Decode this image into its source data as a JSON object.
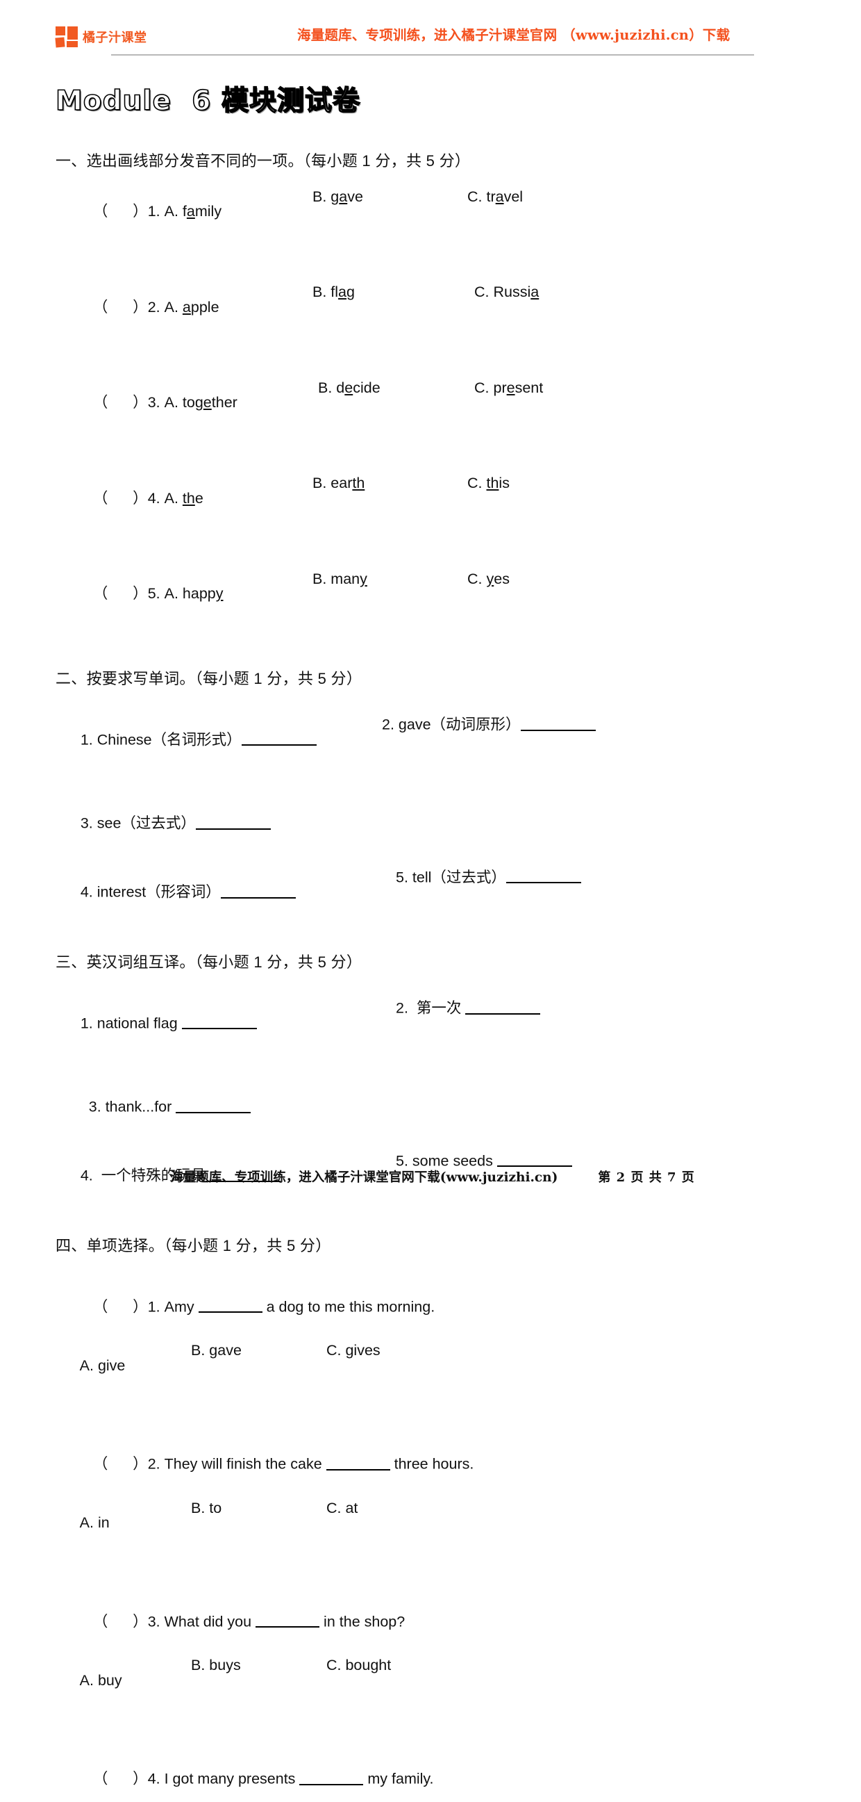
{
  "header": {
    "brand_name": "橘子汁课堂",
    "logo_icon": "orange-squares-logo-icon",
    "promo": "海量题库、专项训练，进入橘子汁课堂官网 （www.juzizhi.cn）下载",
    "brand_color": "#f15a22",
    "promo_color": "#f4511e"
  },
  "title": "Module  6 模块测试卷",
  "sections": [
    {
      "heading": "一、选出画线部分发音不同的一项。（每小题 1 分，共 5 分）",
      "items": [
        {
          "mark": "（      ）",
          "number": "1.",
          "a": {
            "label": "A. ",
            "pre": "f",
            "u": "a",
            "post": "mily"
          },
          "b": {
            "label": "B. ",
            "pre": "g",
            "u": "a",
            "post": "ve"
          },
          "c": {
            "label": "C. ",
            "pre": "tr",
            "u": "a",
            "post": "vel"
          }
        },
        {
          "mark": "（      ）",
          "number": "2.",
          "a": {
            "label": "A. ",
            "pre": "",
            "u": "a",
            "post": "pple"
          },
          "b": {
            "label": "B. ",
            "pre": "fl",
            "u": "a",
            "post": "g"
          },
          "c": {
            "label": "C. ",
            "pre": "Russi",
            "u": "a",
            "post": ""
          }
        },
        {
          "mark": "（      ）",
          "number": "3.",
          "a": {
            "label": "A. ",
            "pre": "tog",
            "u": "e",
            "post": "ther"
          },
          "b": {
            "label": "B. ",
            "pre": "d",
            "u": "e",
            "post": "cide"
          },
          "c": {
            "label": "C. ",
            "pre": "pr",
            "u": "e",
            "post": "sent"
          }
        },
        {
          "mark": "（      ）",
          "number": "4.",
          "a": {
            "label": "A. ",
            "pre": "",
            "u": "th",
            "post": "e"
          },
          "b": {
            "label": "B. ",
            "pre": "ear",
            "u": "th",
            "post": ""
          },
          "c": {
            "label": "C. ",
            "pre": "",
            "u": "th",
            "post": "is"
          }
        },
        {
          "mark": "（      ）",
          "number": "5.",
          "a": {
            "label": "A. ",
            "pre": "happ",
            "u": "y",
            "post": ""
          },
          "b": {
            "label": "B. ",
            "pre": "man",
            "u": "y",
            "post": ""
          },
          "c": {
            "label": "C. ",
            "pre": "",
            "u": "y",
            "post": "es"
          }
        }
      ]
    },
    {
      "heading": "二、按要求写单词。（每小题 1 分，共 5 分）",
      "lines": [
        {
          "left": "1. Chinese（名词形式）",
          "right": "2. gave（动词原形）"
        },
        {
          "left": "3. see（过去式）",
          "right": ""
        },
        {
          "left": "4. interest（形容词）",
          "right": "5. tell（过去式）"
        }
      ]
    },
    {
      "heading": "三、英汉词组互译。（每小题 1 分，共 5 分）",
      "lines": [
        {
          "left": "1. national flag ",
          "right": "2.  第一次 "
        },
        {
          "left": "  3. thank...for ",
          "right": ""
        },
        {
          "left": "4.  一个特殊的玩具",
          "right": "5. some seeds "
        }
      ]
    },
    {
      "heading": "四、单项选择。（每小题 1 分，共 5 分）",
      "questions": [
        {
          "mark": "（      ）",
          "number": "1.",
          "stem_pre": "Amy ",
          "stem_post": " a dog to me this morning.",
          "options": [
            "A. give",
            "B. gave",
            "C. gives"
          ]
        },
        {
          "mark": "（      ）",
          "number": "2.",
          "stem_pre": "They will finish the cake ",
          "stem_post": " three hours.",
          "options": [
            "A. in",
            "B. to",
            "C. at"
          ]
        },
        {
          "mark": "（      ）",
          "number": "3.",
          "stem_pre": "What did you ",
          "stem_post": " in the shop?",
          "options": [
            "A. buy",
            "B. buys",
            "C. bought"
          ]
        },
        {
          "mark": "（      ）",
          "number": "4.",
          "stem_pre": "I got many presents ",
          "stem_post": " my family.",
          "options": []
        }
      ]
    }
  ],
  "footer": {
    "promo": "海量题库、专项训练，进入橘子汁课堂官网下载(www.juzizhi.cn)",
    "page": "第 2 页 共 7 页"
  }
}
